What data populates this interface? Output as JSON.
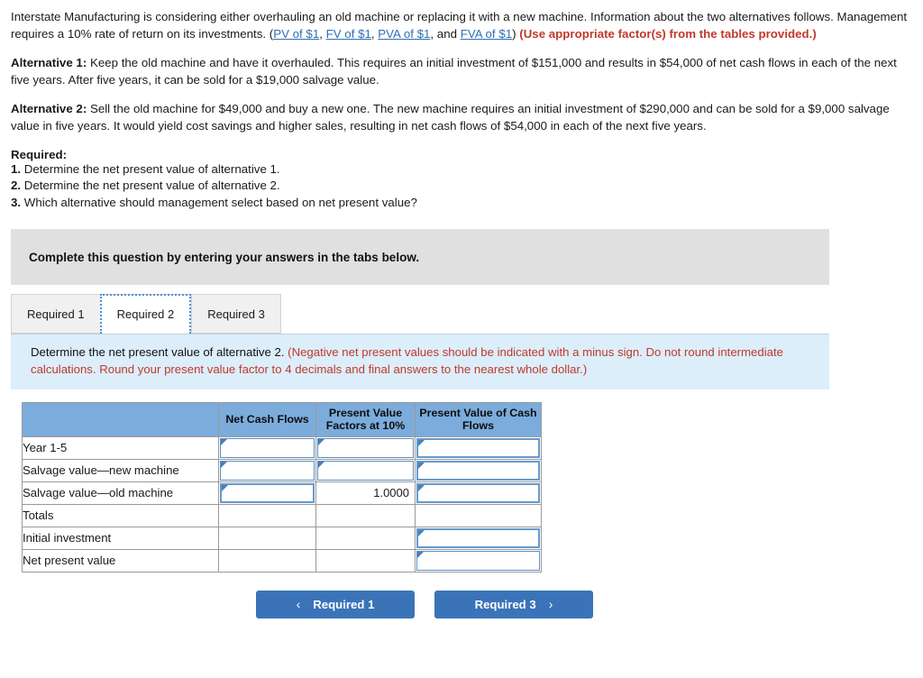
{
  "problem": {
    "intro_part1": "Interstate Manufacturing is considering either overhauling an old machine or replacing it with a new machine. Information about the two alternatives follows. Management requires a 10% rate of return on its investments. (",
    "links": [
      {
        "label": "PV of $1"
      },
      {
        "label": "FV of $1"
      },
      {
        "label": "PVA of $1"
      },
      {
        "label": "FVA of $1"
      }
    ],
    "link_sep1": ", ",
    "link_sep2": ", ",
    "link_sep3": ", and ",
    "intro_part2": ")",
    "use_factors_note": "(Use appropriate factor(s) from the tables provided.)",
    "alt1_label": "Alternative 1:",
    "alt1_text": " Keep the old machine and have it overhauled. This requires an initial investment of $151,000 and results in $54,000 of net cash flows in each of the next five years. After five years, it can be sold for a $19,000 salvage value.",
    "alt2_label": "Alternative 2:",
    "alt2_text": " Sell the old machine for $49,000 and buy a new one. The new machine requires an initial investment of $290,000 and can be sold for a $9,000 salvage value in five years. It would yield cost savings and higher sales, resulting in net cash flows of $54,000 in each of the next five years.",
    "required_heading": "Required:",
    "required_items": [
      {
        "num": "1.",
        "text": " Determine the net present value of alternative 1."
      },
      {
        "num": "2.",
        "text": " Determine the net present value of alternative 2."
      },
      {
        "num": "3.",
        "text": " Which alternative should management select based on net present value?"
      }
    ]
  },
  "banner": {
    "text": "Complete this question by entering your answers in the tabs below."
  },
  "tabs": [
    {
      "label": "Required 1",
      "active": false
    },
    {
      "label": "Required 2",
      "active": true
    },
    {
      "label": "Required 3",
      "active": false
    }
  ],
  "instruction": {
    "question": "Determine the net present value of alternative 2. ",
    "note": "(Negative net present values should be indicated with a minus sign. Do not round intermediate calculations. Round your present value factor to 4 decimals and final answers to the nearest whole dollar.)"
  },
  "table": {
    "headers": {
      "label": "",
      "net_cash_flows": "Net Cash Flows",
      "pv_factors": "Present Value Factors at 10%",
      "pv_cash_flows": "Present Value of Cash Flows"
    },
    "rows": [
      {
        "label": "Year 1-5",
        "net_cash_flows": {
          "input": true,
          "value": ""
        },
        "pv_factors": {
          "input": true,
          "value": ""
        },
        "pv_cash_flows": {
          "input": true,
          "value": ""
        }
      },
      {
        "label": "Salvage value—new machine",
        "net_cash_flows": {
          "input": true,
          "value": ""
        },
        "pv_factors": {
          "input": true,
          "value": ""
        },
        "pv_cash_flows": {
          "input": true,
          "value": ""
        }
      },
      {
        "label": "Salvage value—old machine",
        "net_cash_flows": {
          "input": true,
          "value": ""
        },
        "pv_factors": {
          "input": false,
          "value": "1.0000"
        },
        "pv_cash_flows": {
          "input": true,
          "value": ""
        }
      },
      {
        "label": "Totals",
        "net_cash_flows": {
          "input": false,
          "value": ""
        },
        "pv_factors": {
          "input": false,
          "value": ""
        },
        "pv_cash_flows": {
          "input": false,
          "value": ""
        }
      },
      {
        "label": "Initial investment",
        "net_cash_flows": {
          "input": false,
          "value": ""
        },
        "pv_factors": {
          "input": false,
          "value": ""
        },
        "pv_cash_flows": {
          "input": true,
          "value": ""
        }
      },
      {
        "label": "Net present value",
        "net_cash_flows": {
          "input": false,
          "value": ""
        },
        "pv_factors": {
          "input": false,
          "value": ""
        },
        "pv_cash_flows": {
          "input": true,
          "value": ""
        }
      }
    ]
  },
  "footer": {
    "prev_label": "Required 1",
    "prev_chevron": "‹",
    "next_label": "Required 3",
    "next_chevron": "›"
  },
  "colors": {
    "table_header_blue": "#7bacdb",
    "instruction_blue": "#dceefa",
    "banner_gray": "#e0e0e0",
    "button_blue": "#3b73b9",
    "note_red": "#c0392b",
    "link_blue": "#2f6fb5"
  }
}
